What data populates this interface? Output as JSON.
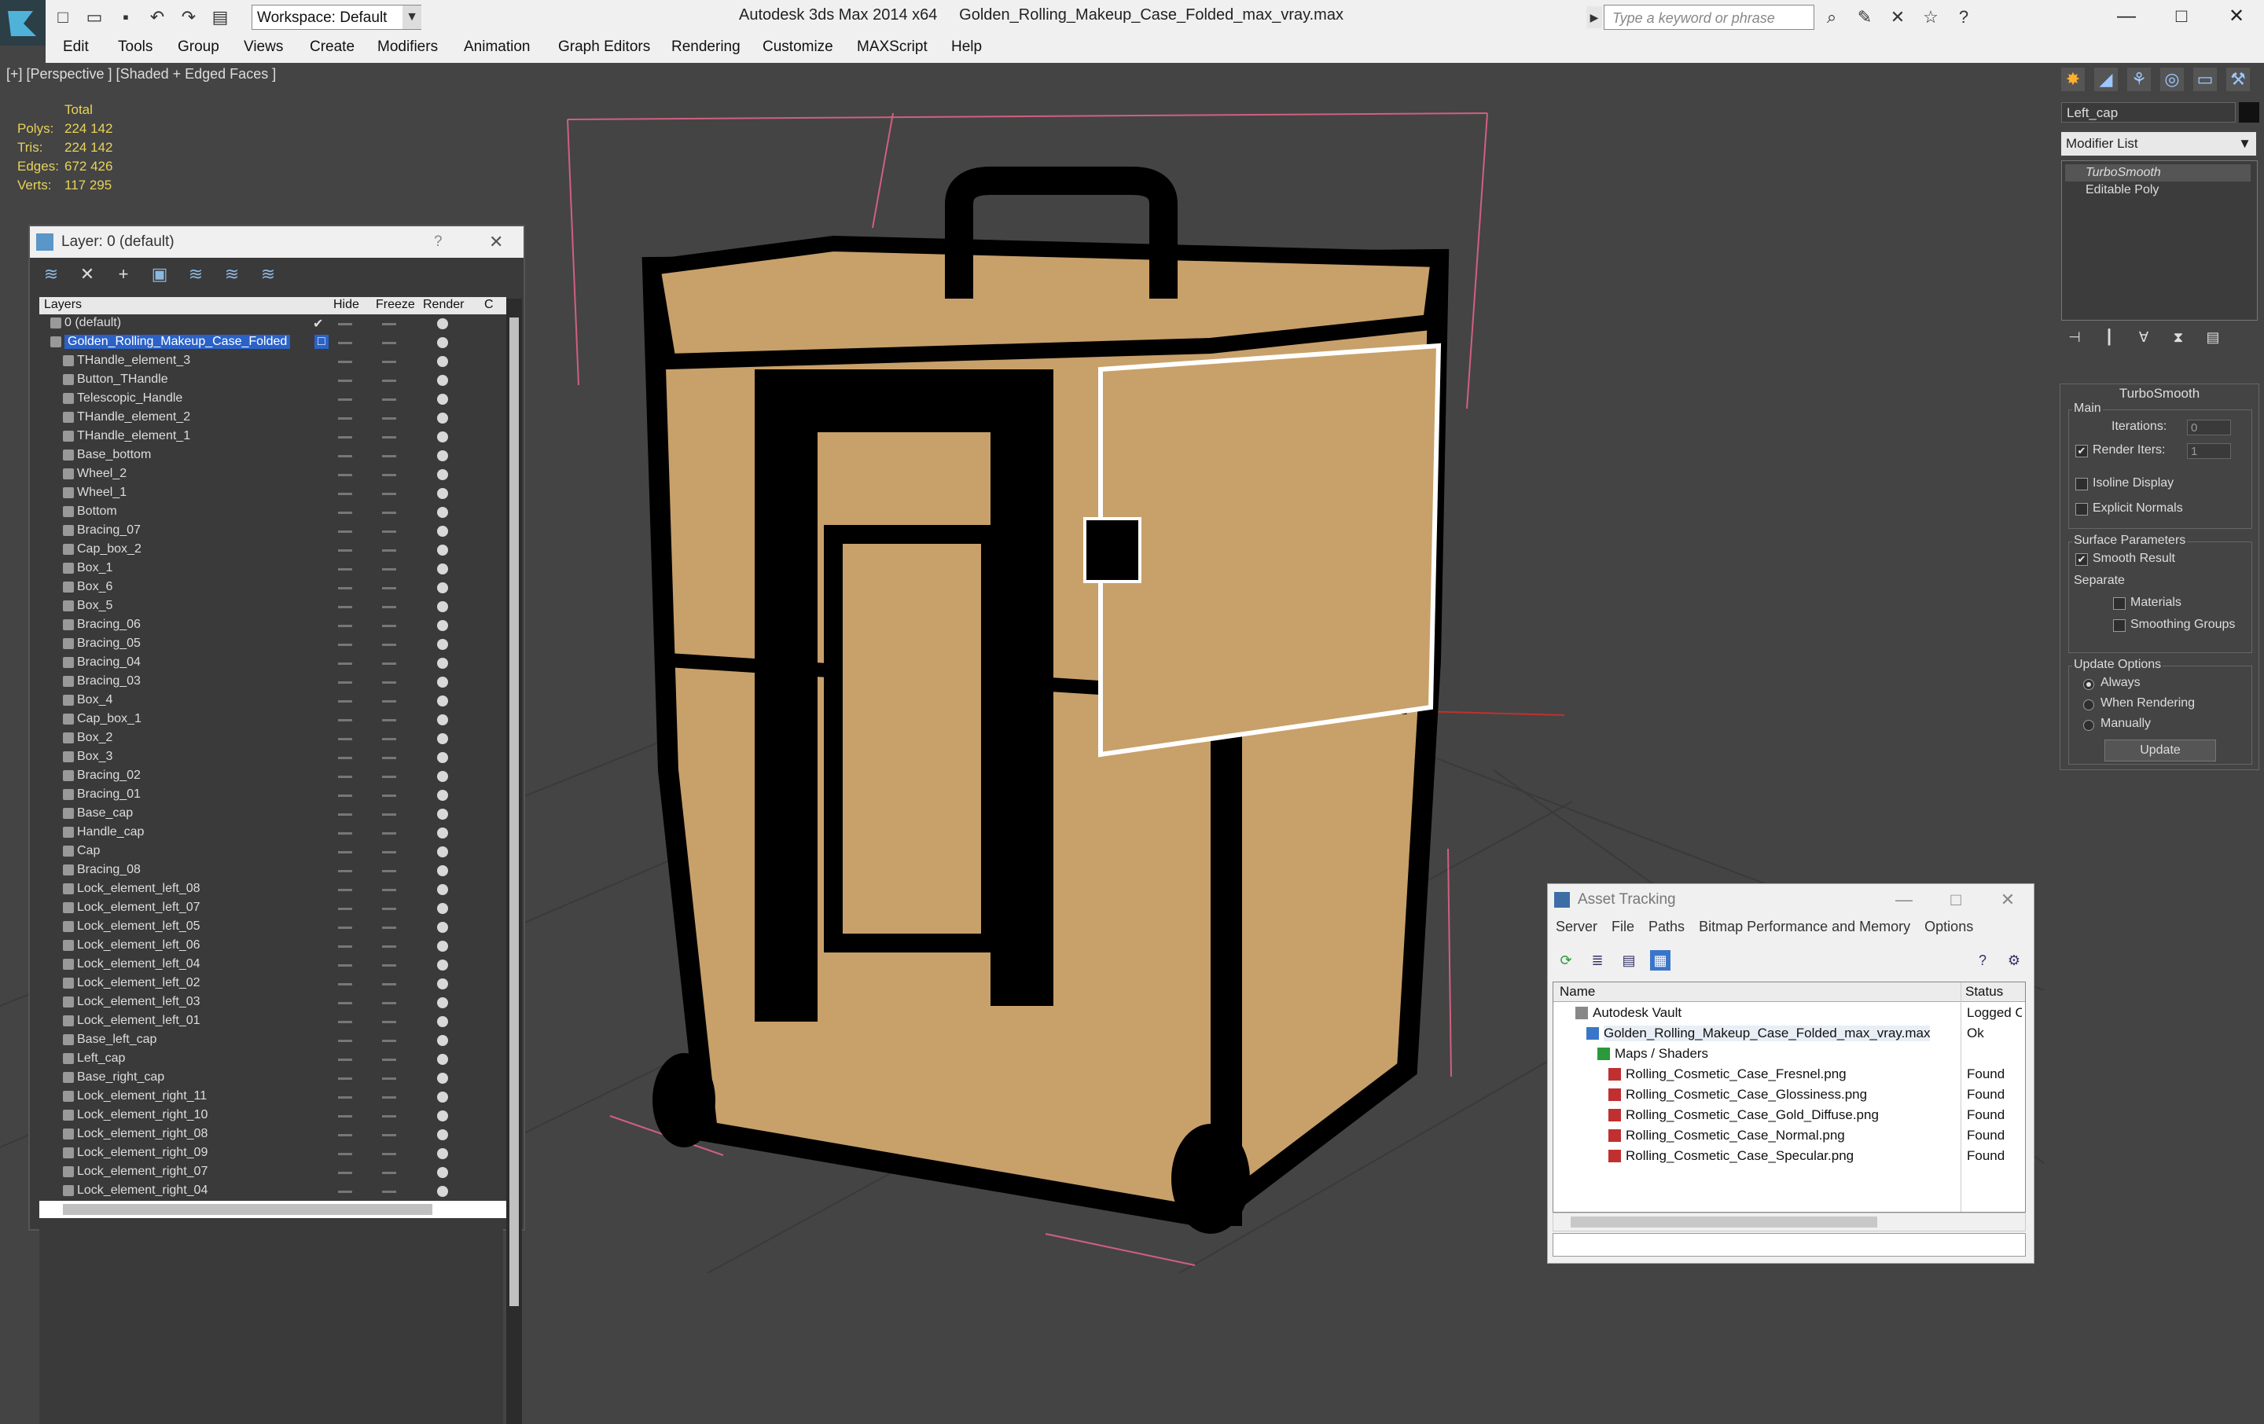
{
  "app": {
    "title": "Autodesk 3ds Max 2014 x64     Golden_Rolling_Makeup_Case_Folded_max_vray.max",
    "workspace": "Workspace: Default",
    "search_placeholder": "Type a keyword or phrase"
  },
  "menu": [
    "Edit",
    "Tools",
    "Group",
    "Views",
    "Create",
    "Modifiers",
    "Animation",
    "Graph Editors",
    "Rendering",
    "Customize",
    "MAXScript",
    "Help"
  ],
  "viewport": {
    "label": "[+] [Perspective ] [Shaded + Edged Faces ]",
    "stats": {
      "header": "Total",
      "rows": [
        {
          "k": "Polys:",
          "v": "224 142"
        },
        {
          "k": "Tris:",
          "v": "224 142"
        },
        {
          "k": "Edges:",
          "v": "672 426"
        },
        {
          "k": "Verts:",
          "v": "117 295"
        }
      ]
    }
  },
  "layer_window": {
    "title": "Layer: 0 (default)",
    "help": "?",
    "columns": {
      "layers": "Layers",
      "hide": "Hide",
      "freeze": "Freeze",
      "render": "Render",
      "c": "C"
    },
    "rows": [
      {
        "name": "0 (default)",
        "level": 0,
        "check": "✔"
      },
      {
        "name": "Golden_Rolling_Makeup_Case_Folded",
        "level": 0,
        "selected": true
      },
      {
        "name": "THandle_element_3",
        "level": 1
      },
      {
        "name": "Button_THandle",
        "level": 1
      },
      {
        "name": "Telescopic_Handle",
        "level": 1
      },
      {
        "name": "THandle_element_2",
        "level": 1
      },
      {
        "name": "THandle_element_1",
        "level": 1
      },
      {
        "name": "Base_bottom",
        "level": 1
      },
      {
        "name": "Wheel_2",
        "level": 1
      },
      {
        "name": "Wheel_1",
        "level": 1
      },
      {
        "name": "Bottom",
        "level": 1
      },
      {
        "name": "Bracing_07",
        "level": 1
      },
      {
        "name": "Cap_box_2",
        "level": 1
      },
      {
        "name": "Box_1",
        "level": 1
      },
      {
        "name": "Box_6",
        "level": 1
      },
      {
        "name": "Box_5",
        "level": 1
      },
      {
        "name": "Bracing_06",
        "level": 1
      },
      {
        "name": "Bracing_05",
        "level": 1
      },
      {
        "name": "Bracing_04",
        "level": 1
      },
      {
        "name": "Bracing_03",
        "level": 1
      },
      {
        "name": "Box_4",
        "level": 1
      },
      {
        "name": "Cap_box_1",
        "level": 1
      },
      {
        "name": "Box_2",
        "level": 1
      },
      {
        "name": "Box_3",
        "level": 1
      },
      {
        "name": "Bracing_02",
        "level": 1
      },
      {
        "name": "Bracing_01",
        "level": 1
      },
      {
        "name": "Base_cap",
        "level": 1
      },
      {
        "name": "Handle_cap",
        "level": 1
      },
      {
        "name": "Cap",
        "level": 1
      },
      {
        "name": "Bracing_08",
        "level": 1
      },
      {
        "name": "Lock_element_left_08",
        "level": 1
      },
      {
        "name": "Lock_element_left_07",
        "level": 1
      },
      {
        "name": "Lock_element_left_05",
        "level": 1
      },
      {
        "name": "Lock_element_left_06",
        "level": 1
      },
      {
        "name": "Lock_element_left_04",
        "level": 1
      },
      {
        "name": "Lock_element_left_02",
        "level": 1
      },
      {
        "name": "Lock_element_left_03",
        "level": 1
      },
      {
        "name": "Lock_element_left_01",
        "level": 1
      },
      {
        "name": "Base_left_cap",
        "level": 1
      },
      {
        "name": "Left_cap",
        "level": 1
      },
      {
        "name": "Base_right_cap",
        "level": 1
      },
      {
        "name": "Lock_element_right_11",
        "level": 1
      },
      {
        "name": "Lock_element_right_10",
        "level": 1
      },
      {
        "name": "Lock_element_right_08",
        "level": 1
      },
      {
        "name": "Lock_element_right_09",
        "level": 1
      },
      {
        "name": "Lock_element_right_07",
        "level": 1
      },
      {
        "name": "Lock_element_right_04",
        "level": 1
      }
    ]
  },
  "command_panel": {
    "object_name": "Left_cap",
    "modifier_list": "Modifier List",
    "stack": [
      "TurboSmooth",
      "Editable Poly"
    ],
    "rollout_title": "TurboSmooth",
    "main_label": "Main",
    "iterations_label": "Iterations:",
    "iterations": "0",
    "render_iters_label": "Render Iters:",
    "render_iters": "1",
    "isoline_label": "Isoline Display",
    "explicit_normals_label": "Explicit Normals",
    "surface_params_label": "Surface Parameters",
    "smooth_result_label": "Smooth Result",
    "separate_label": "Separate",
    "materials_label": "Materials",
    "smoothing_groups_label": "Smoothing Groups",
    "update_options_label": "Update Options",
    "always_label": "Always",
    "when_rendering_label": "When Rendering",
    "manually_label": "Manually",
    "update_button": "Update"
  },
  "asset_tracking": {
    "title": "Asset Tracking",
    "menu": [
      "Server",
      "File",
      "Paths",
      "Bitmap Performance and Memory",
      "Options"
    ],
    "col_name": "Name",
    "col_status": "Status",
    "rows": [
      {
        "name": "Autodesk Vault",
        "status": "Logged O",
        "indent": 28
      },
      {
        "name": "Golden_Rolling_Makeup_Case_Folded_max_vray.max",
        "status": "Ok",
        "indent": 42
      },
      {
        "name": "Maps / Shaders",
        "status": "",
        "indent": 56
      },
      {
        "name": "Rolling_Cosmetic_Case_Fresnel.png",
        "status": "Found",
        "indent": 70
      },
      {
        "name": "Rolling_Cosmetic_Case_Glossiness.png",
        "status": "Found",
        "indent": 70
      },
      {
        "name": "Rolling_Cosmetic_Case_Gold_Diffuse.png",
        "status": "Found",
        "indent": 70
      },
      {
        "name": "Rolling_Cosmetic_Case_Normal.png",
        "status": "Found",
        "indent": 70
      },
      {
        "name": "Rolling_Cosmetic_Case_Specular.png",
        "status": "Found",
        "indent": 70
      }
    ]
  },
  "colors": {
    "accent": "#2a62c8",
    "stats": "#e8d25a",
    "case_gold": "#c8a06a",
    "frame": "#000000"
  }
}
